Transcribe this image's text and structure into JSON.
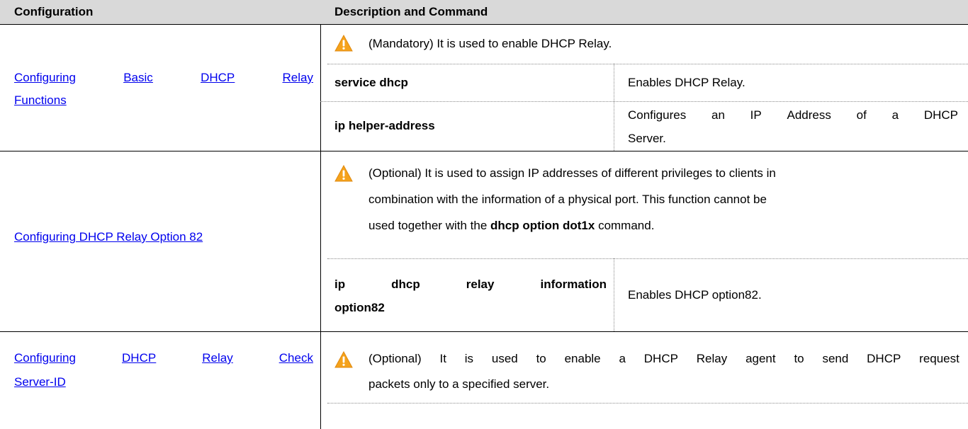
{
  "table": {
    "headers": {
      "configuration": "Configuration",
      "description": "Description and Command"
    },
    "rows": [
      {
        "config_words": [
          "Configuring",
          "Basic",
          "DHCP",
          "Relay"
        ],
        "config_line2": "Functions",
        "note": "(Mandatory) It is used to enable DHCP Relay.",
        "commands": [
          {
            "cmd": "service dhcp",
            "desc": "Enables DHCP Relay."
          },
          {
            "cmd": "ip helper-address",
            "desc_words": [
              "Configures",
              "an",
              "IP",
              "Address",
              "of",
              "a",
              "DHCP"
            ],
            "desc_line2": "Server."
          }
        ]
      },
      {
        "config": "Configuring DHCP Relay Option 82",
        "note_lines": [
          "(Optional) It is used to assign IP addresses of different privileges to clients in",
          "combination with the information of a physical port. This function cannot be"
        ],
        "note_line3_pre": "used together with the ",
        "note_line3_cmd": "dhcp option dot1x",
        "note_line3_post": " command.",
        "commands": [
          {
            "cmd_words": [
              "ip",
              "dhcp",
              "relay",
              "information"
            ],
            "cmd_line2": "option82",
            "desc": "Enables DHCP option82."
          }
        ]
      },
      {
        "config_words": [
          "Configuring",
          "DHCP",
          "Relay",
          "Check"
        ],
        "config_line2": "Server-ID",
        "note_line1_words": [
          "(Optional)",
          "It",
          "is",
          "used",
          "to",
          "enable",
          "a",
          "DHCP",
          "Relay",
          "agent",
          "to",
          "send",
          "DHCP",
          "request"
        ],
        "note_line2": "packets only to a specified server."
      }
    ]
  },
  "icons": {
    "warning": "warning-triangle-icon"
  },
  "colors": {
    "link": "#0000ee",
    "header_bg": "#d9d9d9",
    "warning_fill": "#f5a21b"
  }
}
